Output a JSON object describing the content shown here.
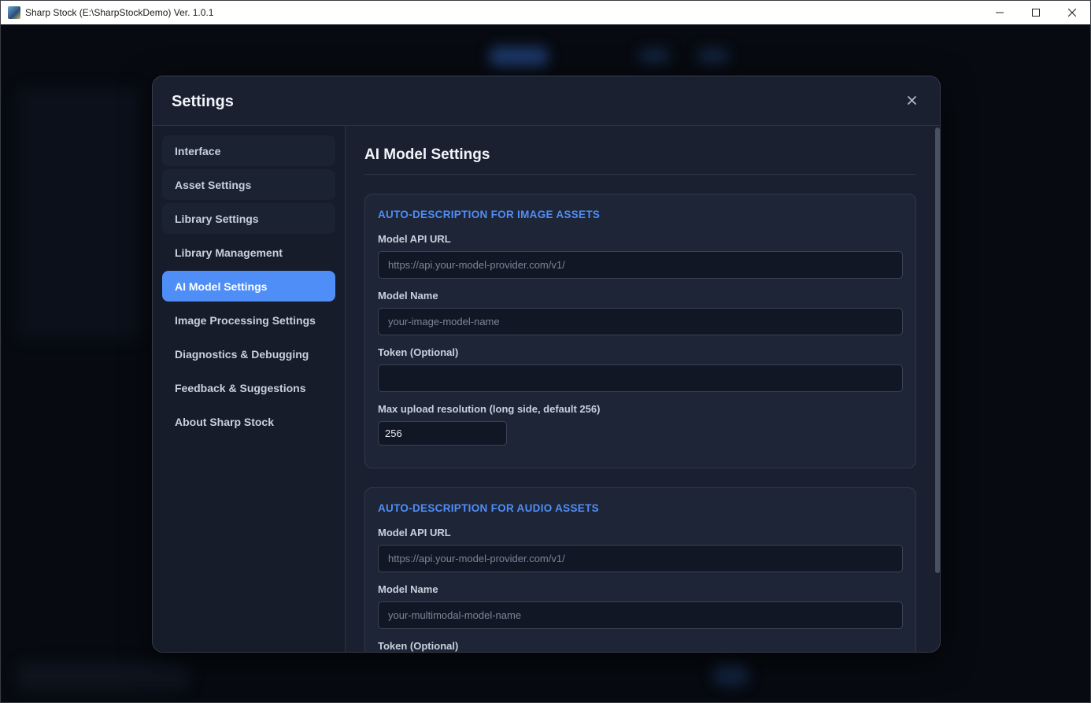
{
  "window": {
    "title": "Sharp Stock (E:\\SharpStockDemo) Ver. 1.0.1",
    "minimize_icon": "minimize-icon",
    "maximize_icon": "maximize-icon",
    "close_icon": "close-icon"
  },
  "dialog": {
    "title": "Settings",
    "close_icon": "close-icon"
  },
  "sidebar": {
    "items": [
      {
        "label": "Interface"
      },
      {
        "label": "Asset Settings"
      },
      {
        "label": "Library Settings"
      },
      {
        "label": "Library Management"
      },
      {
        "label": "AI Model Settings",
        "active": true
      },
      {
        "label": "Image Processing Settings"
      },
      {
        "label": "Diagnostics & Debugging"
      },
      {
        "label": "Feedback & Suggestions"
      },
      {
        "label": "About Sharp Stock"
      }
    ]
  },
  "content": {
    "title": "AI Model Settings",
    "image_card": {
      "heading": "AUTO-DESCRIPTION FOR IMAGE ASSETS",
      "api_url_label": "Model API URL",
      "api_url_placeholder": "https://api.your-model-provider.com/v1/",
      "api_url_value": "",
      "model_name_label": "Model Name",
      "model_name_placeholder": "your-image-model-name",
      "model_name_value": "",
      "token_label": "Token (Optional)",
      "token_value": "",
      "max_res_label": "Max upload resolution (long side, default 256)",
      "max_res_value": "256"
    },
    "audio_card": {
      "heading": "AUTO-DESCRIPTION FOR AUDIO ASSETS",
      "api_url_label": "Model API URL",
      "api_url_placeholder": "https://api.your-model-provider.com/v1/",
      "api_url_value": "",
      "model_name_label": "Model Name",
      "model_name_placeholder": "your-multimodal-model-name",
      "model_name_value": "",
      "token_label": "Token (Optional)"
    }
  },
  "colors": {
    "accent": "#4f8ef7",
    "dialog_bg": "#1a2030",
    "sidebar_bg": "#161c29",
    "card_bg": "#1e2536"
  }
}
